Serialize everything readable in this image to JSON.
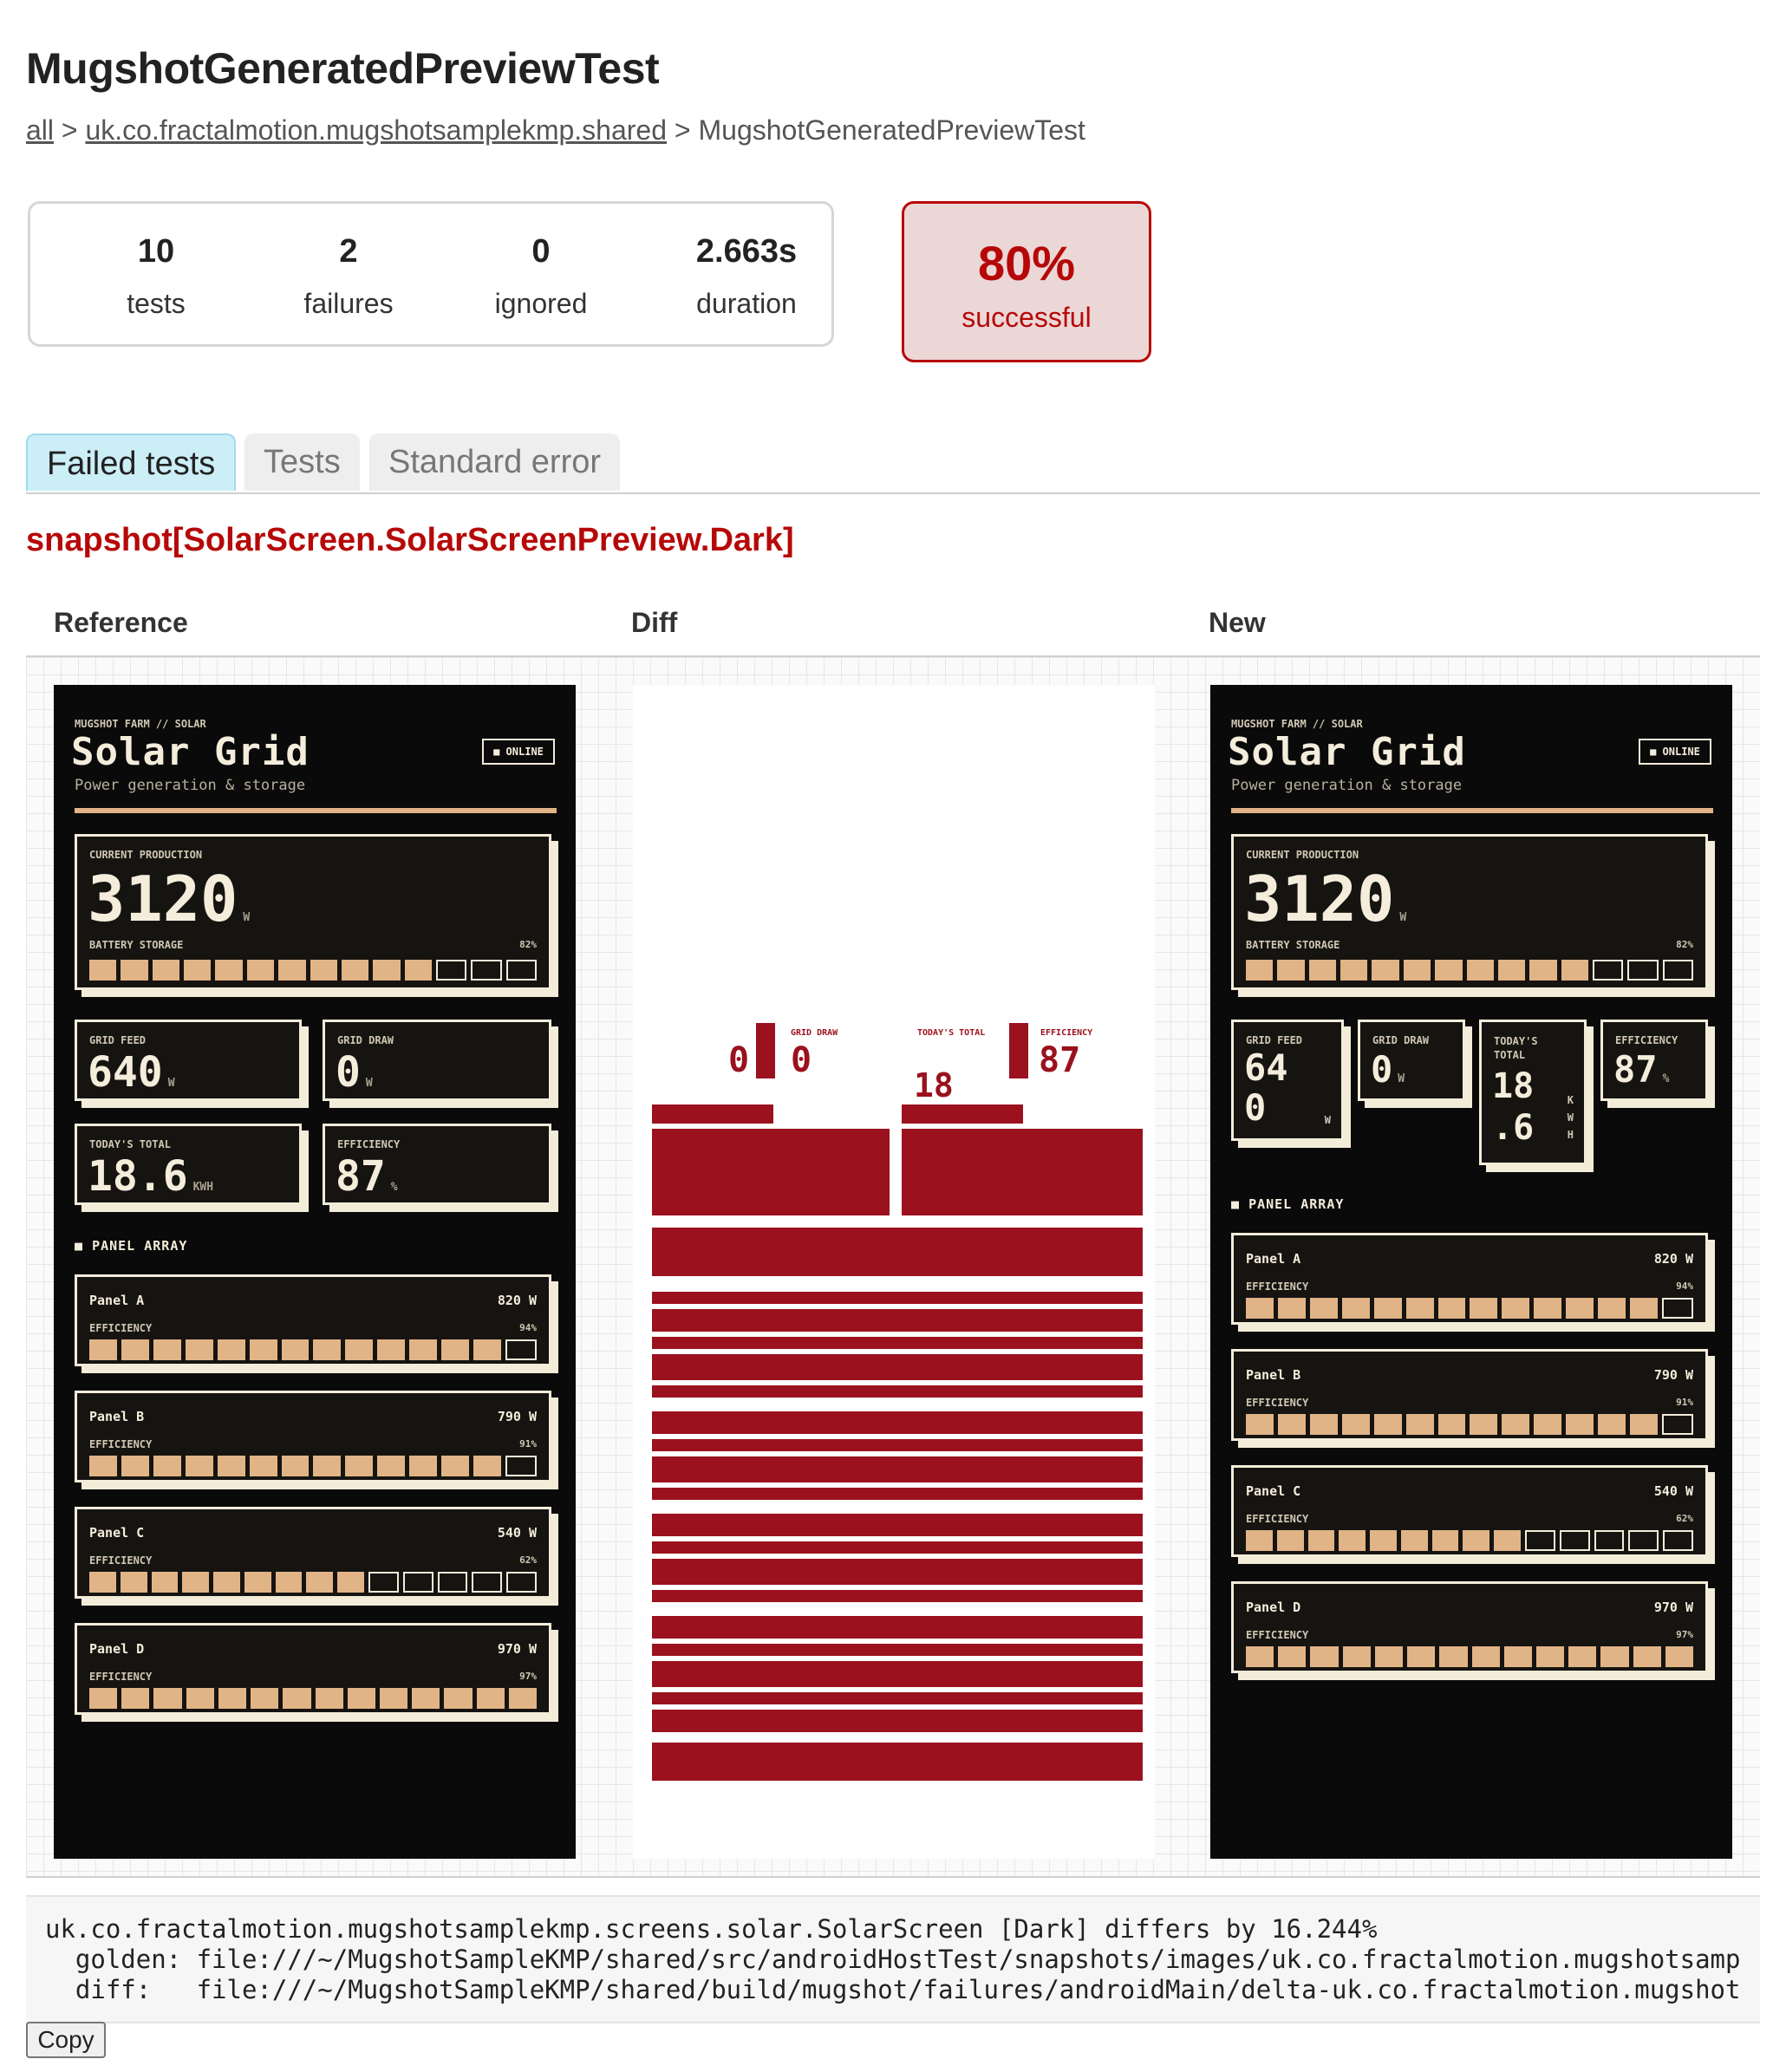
{
  "page": {
    "title": "MugshotGeneratedPreviewTest",
    "breadcrumb": {
      "all": "all",
      "sep1": " > ",
      "package": "uk.co.fractalmotion.mugshotsamplekmp.shared",
      "sep2": " > ",
      "current": "MugshotGeneratedPreviewTest"
    }
  },
  "summary": {
    "tests": {
      "value": "10",
      "label": "tests"
    },
    "failures": {
      "value": "2",
      "label": "failures"
    },
    "ignored": {
      "value": "0",
      "label": "ignored"
    },
    "duration": {
      "value": "2.663s",
      "label": "duration"
    },
    "success": {
      "value": "80%",
      "label": "successful"
    }
  },
  "tabs": [
    "Failed tests",
    "Tests",
    "Standard error"
  ],
  "failure": {
    "title": "snapshot[SolarScreen.SolarScreenPreview.Dark]",
    "columns": {
      "reference": "Reference",
      "diff": "Diff",
      "new": "New"
    }
  },
  "solar": {
    "farm": "MUGSHOT FARM // SOLAR",
    "title": "Solar Grid",
    "tagline": "Power generation & storage",
    "status": "■ ONLINE",
    "current_label": "CURRENT PRODUCTION",
    "current_value": "3120",
    "current_unit": "W",
    "battery_label": "BATTERY STORAGE",
    "battery_pct": "82%",
    "battery_level": 0.82,
    "grid_feed_label": "GRID FEED",
    "grid_feed_value": "640",
    "grid_draw_label": "GRID DRAW",
    "grid_draw_value": "0",
    "power_unit": "W",
    "today_label": "TODAY'S TOTAL",
    "today_value": "18.6",
    "today_unit": "KWH",
    "today_label_line1": "TODAY'S",
    "today_label_line2": "TOTAL",
    "today_value_line1": "18",
    "today_value_line2": ".6",
    "unit_k": "K",
    "unit_w": "W",
    "unit_h": "H",
    "efficiency_label": "EFFICIENCY",
    "efficiency_value": "87",
    "efficiency_unit": "%",
    "grid_feed_value_line1": "64",
    "grid_feed_value_line2": "0",
    "section": "PANEL ARRAY",
    "panels": [
      {
        "name": "Panel A",
        "power": "820 W",
        "eff_label": "EFFICIENCY",
        "eff": "94%",
        "level": 0.94
      },
      {
        "name": "Panel B",
        "power": "790 W",
        "eff_label": "EFFICIENCY",
        "eff": "91%",
        "level": 0.91
      },
      {
        "name": "Panel C",
        "power": "540 W",
        "eff_label": "EFFICIENCY",
        "eff": "62%",
        "level": 0.62
      },
      {
        "name": "Panel D",
        "power": "970 W",
        "eff_label": "EFFICIENCY",
        "eff": "97%",
        "level": 0.97
      }
    ]
  },
  "error": {
    "line1": "uk.co.fractalmotion.mugshotsamplekmp.screens.solar.SolarScreen [Dark] differs by 16.244%",
    "line2": "  golden: file:///~/MugshotSampleKMP/shared/src/androidHostTest/snapshots/images/uk.co.fractalmotion.mugshotsamp",
    "line3": "  diff:   file:///~/MugshotSampleKMP/shared/build/mugshot/failures/androidMain/delta-uk.co.fractalmotion.mugshot"
  },
  "copy_label": "Copy",
  "colors": {
    "fail": "#b60808",
    "diff": "#9b111e",
    "accent": "#e1b487",
    "screen_bg": "#0a0a0a"
  }
}
